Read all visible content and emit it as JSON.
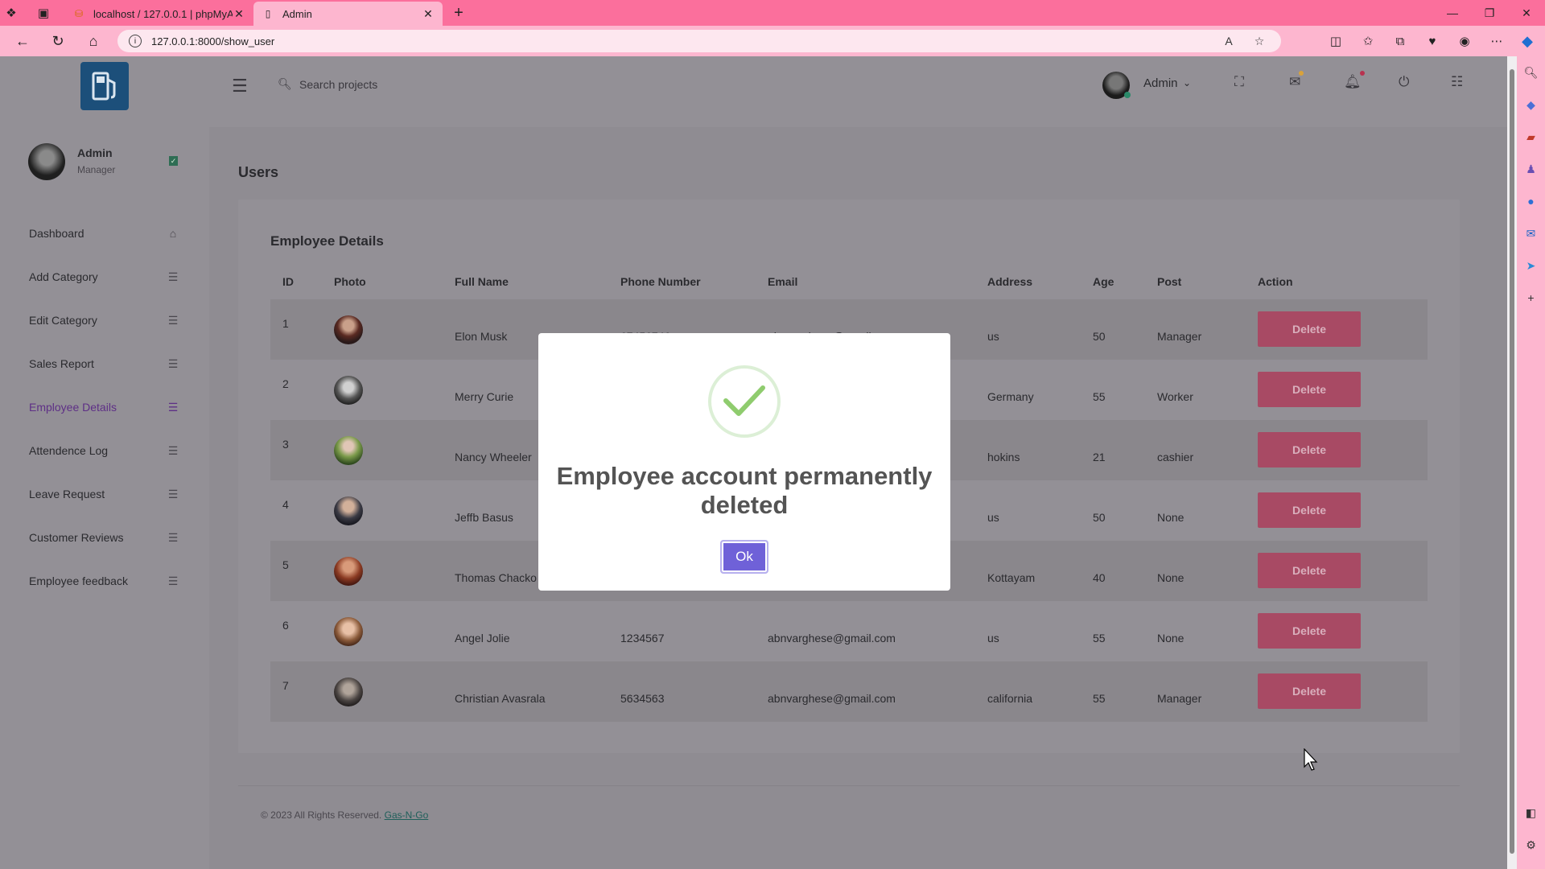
{
  "browser": {
    "tabs": [
      {
        "title": "localhost / 127.0.0.1 | phpMyAdmin",
        "active": false
      },
      {
        "title": "Admin",
        "active": true
      }
    ],
    "url": "127.0.0.1:8000/show_user",
    "window_controls": [
      "minimize",
      "restore",
      "close"
    ]
  },
  "header": {
    "search_placeholder": "Search projects",
    "user_name": "Admin"
  },
  "sidebar": {
    "profile_name": "Admin",
    "profile_role": "Manager",
    "items": [
      {
        "label": "Dashboard",
        "icon": "home-icon"
      },
      {
        "label": "Add Category",
        "icon": "list-icon"
      },
      {
        "label": "Edit Category",
        "icon": "list-icon"
      },
      {
        "label": "Sales Report",
        "icon": "list-icon"
      },
      {
        "label": "Employee Details",
        "icon": "list-icon",
        "active": true
      },
      {
        "label": "Attendence Log",
        "icon": "list-icon"
      },
      {
        "label": "Leave Request",
        "icon": "list-icon"
      },
      {
        "label": "Customer Reviews",
        "icon": "list-icon"
      },
      {
        "label": "Employee feedback",
        "icon": "list-icon"
      }
    ]
  },
  "main": {
    "page_title": "Users",
    "card_title": "Employee Details",
    "columns": [
      "ID",
      "Photo",
      "Full Name",
      "Phone Number",
      "Email",
      "Address",
      "Age",
      "Post",
      "Action"
    ],
    "rows": [
      {
        "id": "1",
        "name": "Elon Musk",
        "phone": "67456746",
        "email": "abnvarghese@gmail.com",
        "address": "us",
        "age": "50",
        "post": "Manager",
        "action": "Delete"
      },
      {
        "id": "2",
        "name": "Merry Curie",
        "phone": "",
        "email": "",
        "address": "Germany",
        "age": "55",
        "post": "Worker",
        "action": "Delete"
      },
      {
        "id": "3",
        "name": "Nancy Wheeler",
        "phone": "",
        "email": "",
        "address": "hokins",
        "age": "21",
        "post": "cashier",
        "action": "Delete"
      },
      {
        "id": "4",
        "name": "Jeffb Basus",
        "phone": "",
        "email": "",
        "address": "us",
        "age": "50",
        "post": "None",
        "action": "Delete"
      },
      {
        "id": "5",
        "name": "Thomas Chacko",
        "phone": "",
        "email": "",
        "address": "Kottayam",
        "age": "40",
        "post": "None",
        "action": "Delete"
      },
      {
        "id": "6",
        "name": "Angel Jolie",
        "phone": "1234567",
        "email": "abnvarghese@gmail.com",
        "address": "us",
        "age": "55",
        "post": "None",
        "action": "Delete"
      },
      {
        "id": "7",
        "name": "Christian Avasrala",
        "phone": "5634563",
        "email": "abnvarghese@gmail.com",
        "address": "california",
        "age": "55",
        "post": "Manager",
        "action": "Delete"
      }
    ]
  },
  "footer": {
    "text": "© 2023 All Rights Reserved.",
    "link": "Gas-N-Go"
  },
  "modal": {
    "message": "Employee account permanently deleted",
    "ok_label": "Ok"
  },
  "colors": {
    "browser_accent": "#fb6f9c",
    "modal_button": "#6f61d8",
    "delete_button": "#a84a64",
    "success_check": "#8fcc6e"
  }
}
